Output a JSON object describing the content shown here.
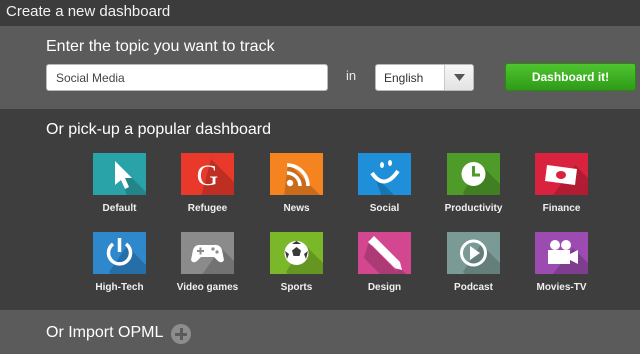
{
  "header": {
    "title": "Create a new dashboard"
  },
  "topic": {
    "prompt": "Enter the topic you want to track",
    "input_value": "Social Media",
    "in_label": "in",
    "language": "English",
    "submit_label": "Dashboard it!"
  },
  "popular": {
    "heading": "Or pick-up a popular dashboard",
    "tiles": [
      {
        "label": "Default",
        "icon": "cursor-icon",
        "color": "#2aa3a8"
      },
      {
        "label": "Refugee",
        "icon": "google-g-icon",
        "color": "#e8392b"
      },
      {
        "label": "News",
        "icon": "rss-icon",
        "color": "#f58320"
      },
      {
        "label": "Social",
        "icon": "smiley-icon",
        "color": "#1e8fd8"
      },
      {
        "label": "Productivity",
        "icon": "clock-icon",
        "color": "#4f9b2a"
      },
      {
        "label": "Finance",
        "icon": "money-icon",
        "color": "#d9233e"
      },
      {
        "label": "High-Tech",
        "icon": "power-icon",
        "color": "#2f87cc"
      },
      {
        "label": "Video games",
        "icon": "gamepad-icon",
        "color": "#8b8b8b"
      },
      {
        "label": "Sports",
        "icon": "soccer-ball-icon",
        "color": "#7ab829"
      },
      {
        "label": "Design",
        "icon": "pencil-icon",
        "color": "#d2478f"
      },
      {
        "label": "Podcast",
        "icon": "play-icon",
        "color": "#7a9a95"
      },
      {
        "label": "Movies-TV",
        "icon": "camera-icon",
        "color": "#9c4bb0"
      }
    ]
  },
  "opml": {
    "label": "Or Import OPML"
  }
}
